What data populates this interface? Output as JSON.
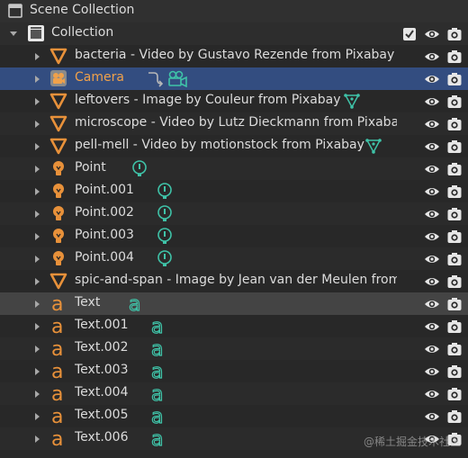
{
  "scene": {
    "label": "Scene Collection"
  },
  "collection": {
    "label": "Collection"
  },
  "items": [
    {
      "label": "bacteria - Video by Gustavo Rezende from Pixabay",
      "type": "image-empty"
    },
    {
      "label": "Camera",
      "type": "camera"
    },
    {
      "label": "leftovers - Image by Couleur from Pixabay",
      "type": "image-empty"
    },
    {
      "label": "microscope - Video by Lutz Dieckmann from Pixabay",
      "type": "image-empty"
    },
    {
      "label": "pell-mell - Video by motionstock from Pixabay",
      "type": "image-empty"
    },
    {
      "label": "Point",
      "type": "light"
    },
    {
      "label": "Point.001",
      "type": "light"
    },
    {
      "label": "Point.002",
      "type": "light"
    },
    {
      "label": "Point.003",
      "type": "light"
    },
    {
      "label": "Point.004",
      "type": "light"
    },
    {
      "label": "spic-and-span - Image by Jean van der Meulen from Pixabay",
      "type": "image-empty"
    },
    {
      "label": "Text",
      "type": "text"
    },
    {
      "label": "Text.001",
      "type": "text"
    },
    {
      "label": "Text.002",
      "type": "text"
    },
    {
      "label": "Text.003",
      "type": "text"
    },
    {
      "label": "Text.004",
      "type": "text"
    },
    {
      "label": "Text.005",
      "type": "text"
    },
    {
      "label": "Text.006",
      "type": "text"
    }
  ],
  "watermark": "@稀土掘金技术社区",
  "colors": {
    "object_orange": "#e8913a",
    "data_teal": "#3fc3a8",
    "selected_row": "#334d80",
    "text_row_highlight": "#444444"
  }
}
